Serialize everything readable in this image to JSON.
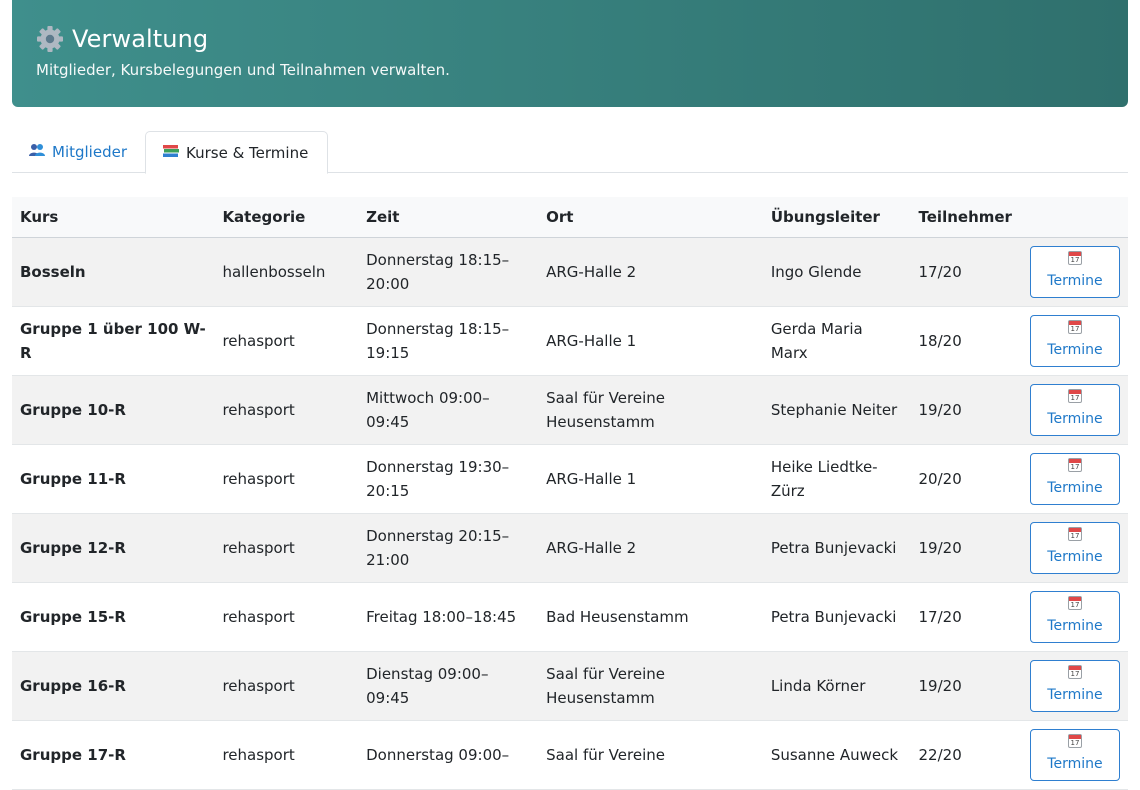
{
  "header": {
    "icon": "gear-icon",
    "title": "Verwaltung",
    "subtitle": "Mitglieder, Kursbelegungen und Teilnahmen verwalten."
  },
  "tabs": [
    {
      "label": "Mitglieder",
      "icon": "people-icon",
      "active": false
    },
    {
      "label": "Kurse & Termine",
      "icon": "books-icon",
      "active": true
    }
  ],
  "table": {
    "columns": [
      "Kurs",
      "Kategorie",
      "Zeit",
      "Ort",
      "Übungsleiter",
      "Teilnehmer"
    ],
    "action_label": "Termine",
    "action_icon": "calendar-icon",
    "calendar_day": "17",
    "rows": [
      {
        "kurs": "Bosseln",
        "kategorie": "hallenbosseln",
        "zeit": "Donnerstag 18:15–20:00",
        "ort": "ARG-Halle 2",
        "leiter": "Ingo Glende",
        "teilnehmer": "17/20"
      },
      {
        "kurs": "Gruppe 1 über 100 W-R",
        "kategorie": "rehasport",
        "zeit": "Donnerstag 18:15–19:15",
        "ort": "ARG-Halle 1",
        "leiter": "Gerda Maria Marx",
        "teilnehmer": "18/20"
      },
      {
        "kurs": "Gruppe 10-R",
        "kategorie": "rehasport",
        "zeit": "Mittwoch 09:00–09:45",
        "ort": "Saal für Vereine Heusenstamm",
        "leiter": "Stephanie Neiter",
        "teilnehmer": "19/20"
      },
      {
        "kurs": "Gruppe 11-R",
        "kategorie": "rehasport",
        "zeit": "Donnerstag 19:30–20:15",
        "ort": "ARG-Halle 1",
        "leiter": "Heike Liedtke-Zürz",
        "teilnehmer": "20/20"
      },
      {
        "kurs": "Gruppe 12-R",
        "kategorie": "rehasport",
        "zeit": "Donnerstag 20:15–21:00",
        "ort": "ARG-Halle 2",
        "leiter": "Petra Bunjevacki",
        "teilnehmer": "19/20"
      },
      {
        "kurs": "Gruppe 15-R",
        "kategorie": "rehasport",
        "zeit": "Freitag 18:00–18:45",
        "ort": "Bad Heusenstamm",
        "leiter": "Petra Bunjevacki",
        "teilnehmer": "17/20"
      },
      {
        "kurs": "Gruppe 16-R",
        "kategorie": "rehasport",
        "zeit": "Dienstag 09:00–09:45",
        "ort": "Saal für Vereine Heusenstamm",
        "leiter": "Linda Körner",
        "teilnehmer": "19/20"
      },
      {
        "kurs": "Gruppe 17-R",
        "kategorie": "rehasport",
        "zeit": "Donnerstag 09:00–",
        "ort": "Saal für Vereine",
        "leiter": "Susanne Auweck",
        "teilnehmer": "22/20"
      }
    ]
  }
}
